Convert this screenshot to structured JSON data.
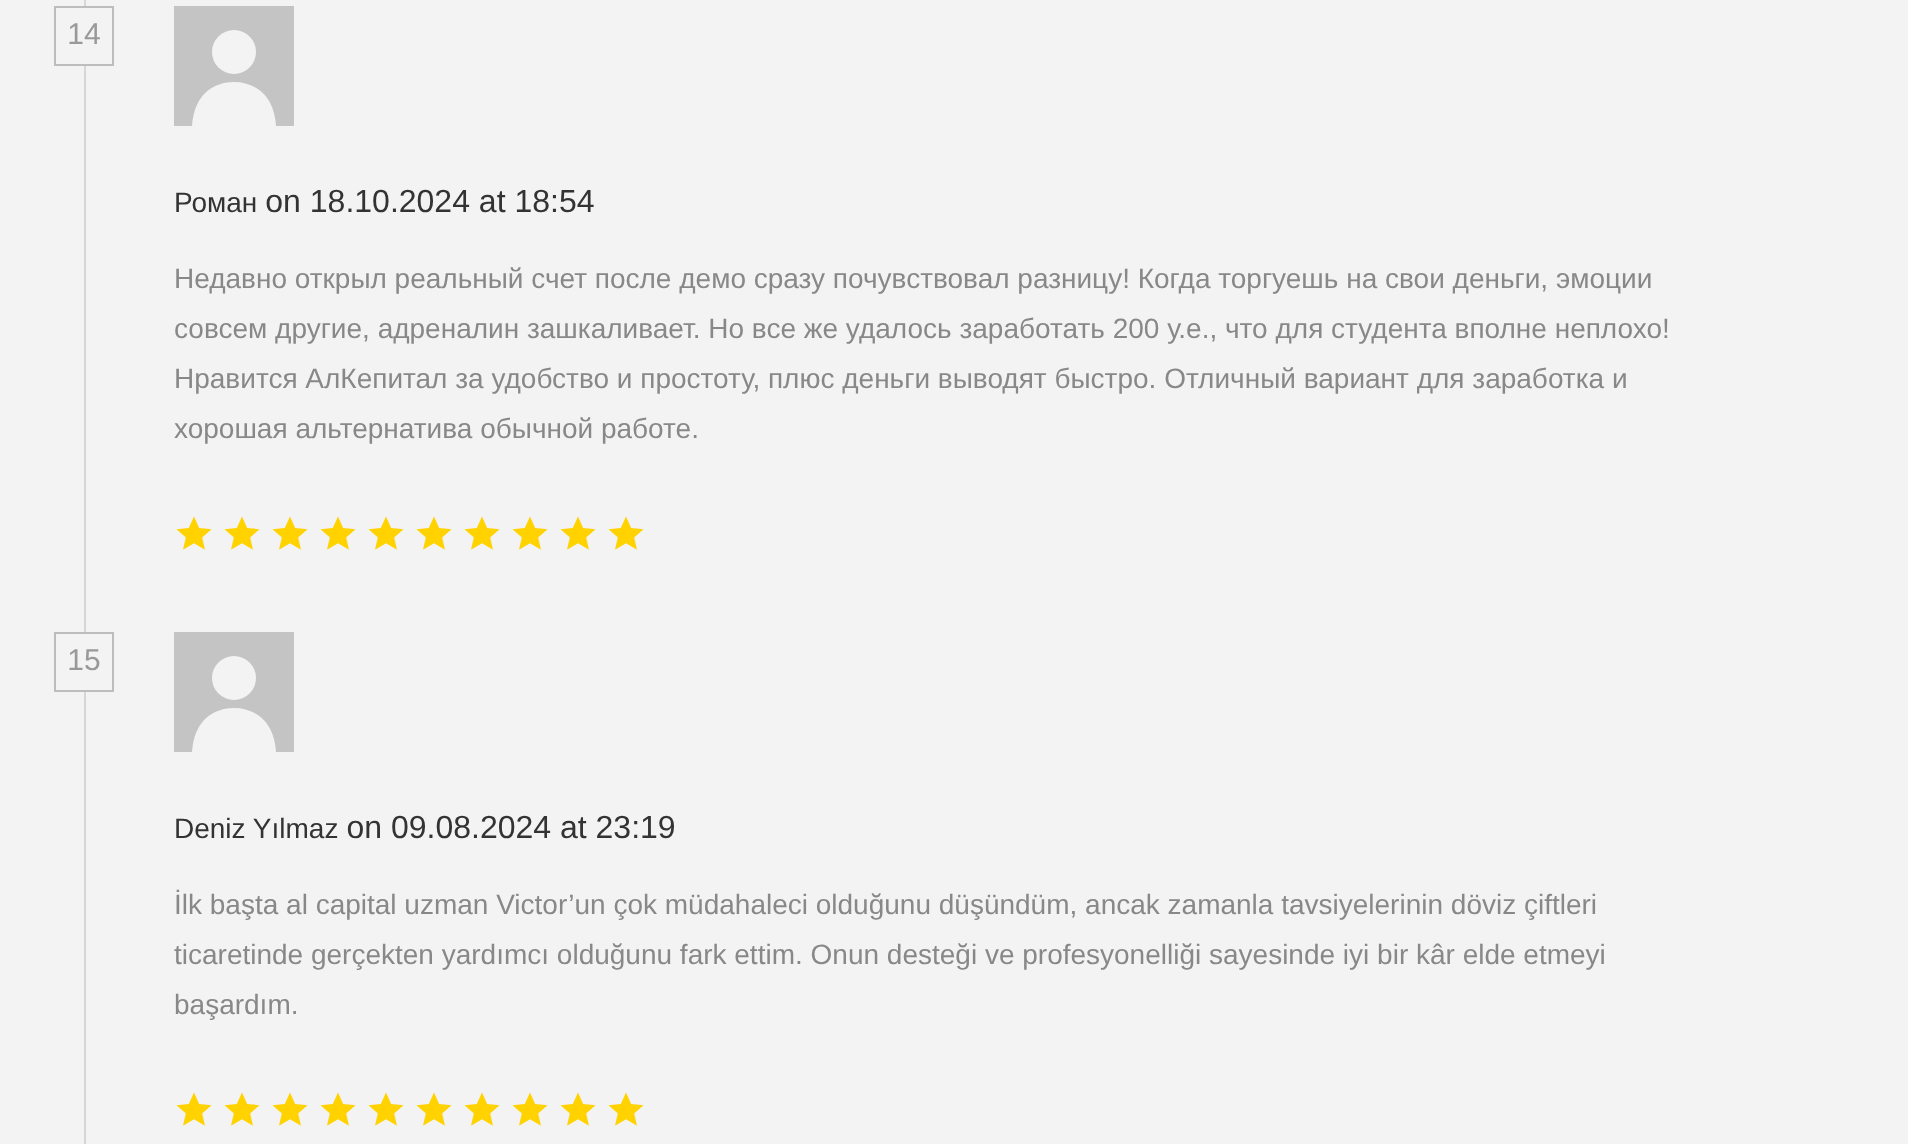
{
  "comments": [
    {
      "number": "14",
      "author": "Роман",
      "date": "on 18.10.2024 at 18:54",
      "text": "Недавно открыл реальный счет после демо сразу почувствовал разницу! Когда торгуешь на свои деньги, эмоции совсем другие, адреналин зашкаливает. Но все же удалось заработать 200 у.е., что для студента вполне неплохо! Нравится АлКепитал за удобство и простоту, плюс деньги выводят быстро. Отличный вариант для заработка и хорошая альтернатива обычной работе.",
      "stars": 10
    },
    {
      "number": "15",
      "author": "Deniz Yılmaz",
      "date": "on 09.08.2024 at 23:19",
      "text": "İlk başta al capital uzman Victor’un çok müdahaleci olduğunu düşündüm, ancak zamanla tavsiyelerinin döviz çiftleri ticaretinde gerçekten yardımcı olduğunu fark ettim. Onun desteği ve profesyonelliği sayesinde iyi bir kâr elde etmeyi başardım.",
      "stars": 10
    }
  ]
}
